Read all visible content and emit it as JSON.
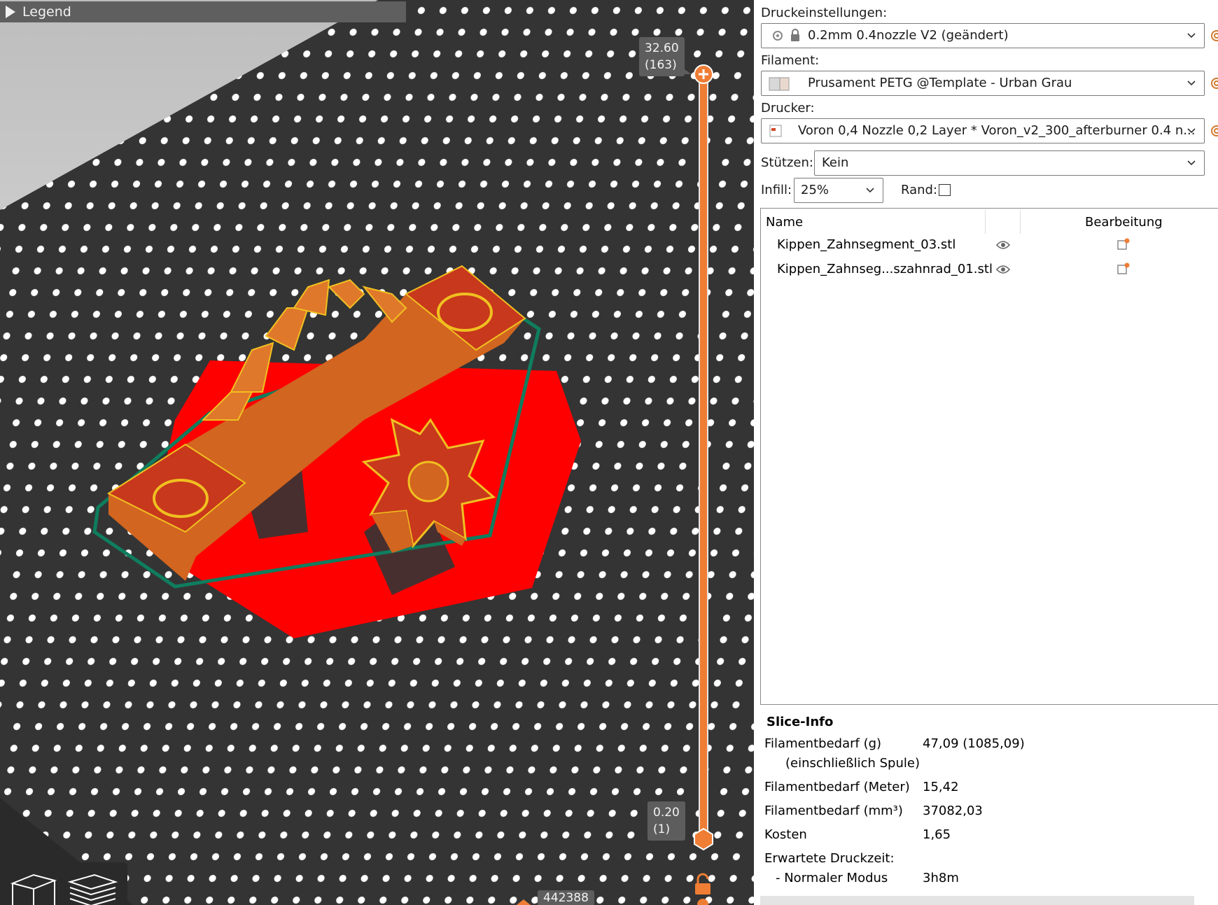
{
  "viewport": {
    "legend_label": "Legend",
    "layer_slider": {
      "top_height": "32.60",
      "top_layer": "(163)",
      "bottom_height": "0.20",
      "bottom_layer": "(1)"
    },
    "move_slider_value": "442388"
  },
  "print_settings": {
    "label": "Druckeinstellungen:",
    "value": "0.2mm 0.4nozzle V2 (geändert)"
  },
  "filament": {
    "label": "Filament:",
    "value": "Prusament PETG @Template - Urban Grau"
  },
  "printer": {
    "label": "Drucker:",
    "value": "Voron 0,4 Nozzle 0,2 Layer * Voron_v2_300_afterburner 0.4 n..."
  },
  "supports": {
    "label": "Stützen:",
    "value": "Kein"
  },
  "infill": {
    "label": "Infill:",
    "value": "25%"
  },
  "brim": {
    "label": "Rand:",
    "checked": false
  },
  "object_list": {
    "col_name": "Name",
    "col_edit": "Bearbeitung",
    "items": [
      {
        "name": "Kippen_Zahnsegment_03.stl"
      },
      {
        "name": "Kippen_Zahnseg...szahnrad_01.stl"
      }
    ]
  },
  "slice_info": {
    "title": "Slice-Info",
    "rows": [
      {
        "key": "Filamentbedarf (g)",
        "value": "47,09 (1085,09)"
      },
      {
        "key": "(einschließlich Spule)",
        "value": ""
      },
      {
        "key": "Filamentbedarf (Meter)",
        "value": "15,42"
      },
      {
        "key": "Filamentbedarf (mm³)",
        "value": "37082,03"
      },
      {
        "key": "Kosten",
        "value": "1,65"
      },
      {
        "key": "Erwartete Druckzeit:",
        "value": ""
      },
      {
        "key": "- Normaler Modus",
        "value": "3h8m"
      }
    ]
  },
  "colors": {
    "accent": "#ef7d34",
    "bed": "#333333",
    "skirt": "#0f7d5e",
    "first_layer": "#ff0000"
  }
}
